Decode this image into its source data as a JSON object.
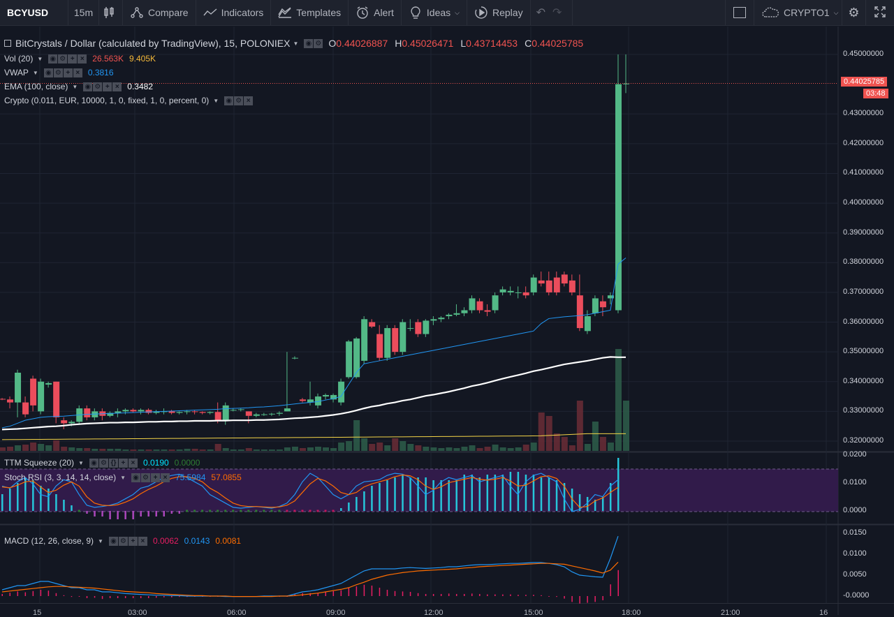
{
  "toolbar": {
    "symbol": "BCYUSD",
    "interval": "15m",
    "compare": "Compare",
    "indicators": "Indicators",
    "templates": "Templates",
    "alert": "Alert",
    "ideas": "Ideas",
    "replay": "Replay",
    "layout_name": "CRYPTO1"
  },
  "main_legend": {
    "title": "BitCrystals / Dollar (calculated by TradingView), 15, POLONIEX",
    "o_label": "O",
    "o_val": "0.44026887",
    "h_label": "H",
    "h_val": "0.45026471",
    "l_label": "L",
    "l_val": "0.43714453",
    "c_label": "C",
    "c_val": "0.44025785"
  },
  "studies": [
    {
      "name": "Vol (20)",
      "v1": "26.563K",
      "v2": "9.405K"
    },
    {
      "name": "VWAP",
      "v1": "0.3816"
    },
    {
      "name": "EMA (100, close)",
      "v1": "0.3482"
    },
    {
      "name": "Crypto (0.011, EUR, 10000, 1, 0, fixed, 1, 0, percent, 0)"
    }
  ],
  "ttm": {
    "name": "TTM Squeeze (20)",
    "v1": "0.0190",
    "v2": "0.0000"
  },
  "stoch": {
    "name": "Stoch RSI (3, 3, 14, 14, close)",
    "v1": "75.5984",
    "v2": "57.0855"
  },
  "macd": {
    "name": "MACD (12, 26, close, 9)",
    "v1": "0.0062",
    "v2": "0.0143",
    "v3": "0.0081"
  },
  "price_axis": [
    "0.45000000",
    "0.43000000",
    "0.42000000",
    "0.41000000",
    "0.40000000",
    "0.39000000",
    "0.38000000",
    "0.37000000",
    "0.36000000",
    "0.35000000",
    "0.34000000",
    "0.33000000",
    "0.32000000"
  ],
  "last_price": "0.44025785",
  "countdown": "03:48",
  "osc_axis": [
    "0.0200",
    "0.0100",
    "0.0000"
  ],
  "macd_axis": [
    "0.0150",
    "0.0100",
    "0.0050",
    "-0.0000"
  ],
  "time_axis": [
    "15",
    "03:00",
    "06:00",
    "09:00",
    "12:00",
    "15:00",
    "18:00",
    "21:00",
    "16"
  ],
  "colors": {
    "up": "#53b987",
    "down": "#eb4d5c",
    "vwap": "#2196f3",
    "ema": "#ffffff",
    "bg": "#131722"
  },
  "chart_data": {
    "type": "candlestick",
    "candles": [
      [
        0.3342,
        0.3345,
        0.3338,
        0.334
      ],
      [
        0.334,
        0.335,
        0.331,
        0.333
      ],
      [
        0.333,
        0.344,
        0.328,
        0.343
      ],
      [
        0.333,
        0.335,
        0.328,
        0.329
      ],
      [
        0.341,
        0.342,
        0.33,
        0.332
      ],
      [
        0.33,
        0.341,
        0.329,
        0.34
      ],
      [
        0.339,
        0.34,
        0.338,
        0.3395
      ],
      [
        0.34,
        0.34,
        0.326,
        0.328
      ],
      [
        0.327,
        0.328,
        0.324,
        0.326
      ],
      [
        0.326,
        0.327,
        0.325,
        0.3265
      ],
      [
        0.3265,
        0.332,
        0.3255,
        0.331
      ],
      [
        0.331,
        0.332,
        0.327,
        0.328
      ],
      [
        0.328,
        0.331,
        0.327,
        0.33
      ],
      [
        0.33,
        0.331,
        0.327,
        0.3285
      ],
      [
        0.3285,
        0.33,
        0.328,
        0.3295
      ],
      [
        0.3295,
        0.331,
        0.328,
        0.33
      ],
      [
        0.33,
        0.331,
        0.329,
        0.3305
      ],
      [
        0.3305,
        0.331,
        0.3295,
        0.33
      ],
      [
        0.33,
        0.331,
        0.329,
        0.3305
      ],
      [
        0.3305,
        0.331,
        0.329,
        0.3295
      ],
      [
        0.3295,
        0.3305,
        0.329,
        0.33
      ],
      [
        0.33,
        0.331,
        0.329,
        0.33
      ],
      [
        0.33,
        0.3305,
        0.329,
        0.3295
      ],
      [
        0.3295,
        0.33,
        0.329,
        0.3298
      ],
      [
        0.3298,
        0.3305,
        0.329,
        0.33
      ],
      [
        0.33,
        0.3305,
        0.329,
        0.3298
      ],
      [
        0.3298,
        0.33,
        0.329,
        0.3295
      ],
      [
        0.3295,
        0.33,
        0.329,
        0.3298
      ],
      [
        0.3298,
        0.333,
        0.326,
        0.327
      ],
      [
        0.327,
        0.333,
        0.3255,
        0.332
      ],
      [
        0.3305,
        0.331,
        0.33,
        0.3305
      ],
      [
        0.3305,
        0.331,
        0.33,
        0.3307
      ],
      [
        0.33,
        0.33,
        0.326,
        0.3285
      ],
      [
        0.3285,
        0.3295,
        0.328,
        0.329
      ],
      [
        0.329,
        0.3295,
        0.3285,
        0.329
      ],
      [
        0.329,
        0.3295,
        0.3285,
        0.3292
      ],
      [
        0.3292,
        0.33,
        0.3285,
        0.3295
      ],
      [
        0.33,
        0.35,
        0.33,
        0.331
      ],
      [
        0.348,
        0.3485,
        0.3475,
        0.348
      ],
      [
        0.334,
        0.3345,
        0.333,
        0.3335
      ],
      [
        0.333,
        0.34,
        0.332,
        0.334
      ],
      [
        0.332,
        0.336,
        0.331,
        0.335
      ],
      [
        0.335,
        0.336,
        0.334,
        0.3355
      ],
      [
        0.334,
        0.336,
        0.333,
        0.3355
      ],
      [
        0.333,
        0.341,
        0.332,
        0.34
      ],
      [
        0.3415,
        0.354,
        0.341,
        0.3535
      ],
      [
        0.3415,
        0.355,
        0.341,
        0.3545
      ],
      [
        0.347,
        0.362,
        0.346,
        0.361
      ],
      [
        0.36,
        0.361,
        0.358,
        0.3585
      ],
      [
        0.356,
        0.359,
        0.347,
        0.348
      ],
      [
        0.348,
        0.359,
        0.347,
        0.358
      ],
      [
        0.358,
        0.359,
        0.349,
        0.35
      ],
      [
        0.35,
        0.361,
        0.349,
        0.36
      ],
      [
        0.358,
        0.361,
        0.357,
        0.358
      ],
      [
        0.36,
        0.361,
        0.355,
        0.356
      ],
      [
        0.356,
        0.361,
        0.355,
        0.3605
      ],
      [
        0.3605,
        0.362,
        0.359,
        0.361
      ],
      [
        0.361,
        0.362,
        0.36,
        0.3615
      ],
      [
        0.362,
        0.363,
        0.361,
        0.3625
      ],
      [
        0.3625,
        0.366,
        0.362,
        0.363
      ],
      [
        0.363,
        0.365,
        0.362,
        0.364
      ],
      [
        0.364,
        0.369,
        0.363,
        0.368
      ],
      [
        0.367,
        0.368,
        0.363,
        0.364
      ],
      [
        0.364,
        0.366,
        0.362,
        0.3635
      ],
      [
        0.364,
        0.37,
        0.363,
        0.369
      ],
      [
        0.37,
        0.372,
        0.369,
        0.371
      ],
      [
        0.37,
        0.372,
        0.369,
        0.3705
      ],
      [
        0.37,
        0.372,
        0.368,
        0.37
      ],
      [
        0.37,
        0.372,
        0.368,
        0.369
      ],
      [
        0.37,
        0.376,
        0.369,
        0.375
      ],
      [
        0.374,
        0.377,
        0.372,
        0.373
      ],
      [
        0.374,
        0.377,
        0.369,
        0.37
      ],
      [
        0.375,
        0.377,
        0.369,
        0.37
      ],
      [
        0.376,
        0.377,
        0.372,
        0.373
      ],
      [
        0.374,
        0.376,
        0.369,
        0.37
      ],
      [
        0.369,
        0.376,
        0.357,
        0.358
      ],
      [
        0.357,
        0.364,
        0.356,
        0.362
      ],
      [
        0.363,
        0.369,
        0.362,
        0.368
      ],
      [
        0.367,
        0.369,
        0.362,
        0.365
      ],
      [
        0.368,
        0.37,
        0.366,
        0.369
      ],
      [
        0.364,
        0.45,
        0.363,
        0.44
      ],
      [
        0.44,
        0.45,
        0.437,
        0.4402
      ]
    ]
  }
}
